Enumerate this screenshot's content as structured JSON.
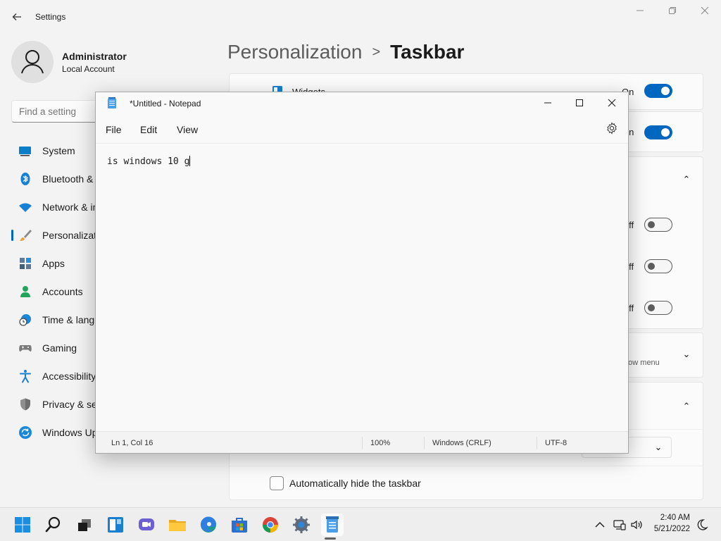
{
  "settings": {
    "app_title": "Settings",
    "user": {
      "name": "Administrator",
      "account_type": "Local Account"
    },
    "search": {
      "placeholder": "Find a setting"
    },
    "nav": [
      {
        "label": "System",
        "icon": "monitor-icon"
      },
      {
        "label": "Bluetooth & devices",
        "icon": "bluetooth-icon"
      },
      {
        "label": "Network & internet",
        "icon": "wifi-icon"
      },
      {
        "label": "Personalization",
        "icon": "brush-icon",
        "active": true
      },
      {
        "label": "Apps",
        "icon": "apps-icon"
      },
      {
        "label": "Accounts",
        "icon": "person-icon"
      },
      {
        "label": "Time & language",
        "icon": "clock-globe-icon"
      },
      {
        "label": "Gaming",
        "icon": "gamepad-icon"
      },
      {
        "label": "Accessibility",
        "icon": "accessibility-icon"
      },
      {
        "label": "Privacy & security",
        "icon": "shield-icon"
      },
      {
        "label": "Windows Update",
        "icon": "update-icon"
      }
    ],
    "breadcrumb": {
      "parent": "Personalization",
      "current": "Taskbar"
    },
    "content": {
      "widgets_label": "Widgets",
      "widgets_state": "On",
      "row2_state": "On",
      "off_label_1": "Off",
      "off_label_2": "Off",
      "off_label_3": "Off",
      "overflow_partial": "rflow menu",
      "auto_hide_label": "Automatically hide the taskbar"
    }
  },
  "notepad": {
    "title": "*Untitled - Notepad",
    "menu": [
      "File",
      "Edit",
      "View"
    ],
    "text": "is windows 10 g",
    "status": {
      "position": "Ln 1, Col 16",
      "zoom": "100%",
      "line_ending": "Windows (CRLF)",
      "encoding": "UTF-8"
    }
  },
  "taskbar": {
    "apps": [
      "start-icon",
      "search-icon",
      "task-view-icon",
      "widgets-icon",
      "chat-icon",
      "file-explorer-icon",
      "edge-icon",
      "store-icon",
      "chrome-icon",
      "settings-icon",
      "notepad-icon"
    ],
    "time": "2:40 AM",
    "date": "5/21/2022"
  },
  "colors": {
    "accent": "#0067c0"
  }
}
